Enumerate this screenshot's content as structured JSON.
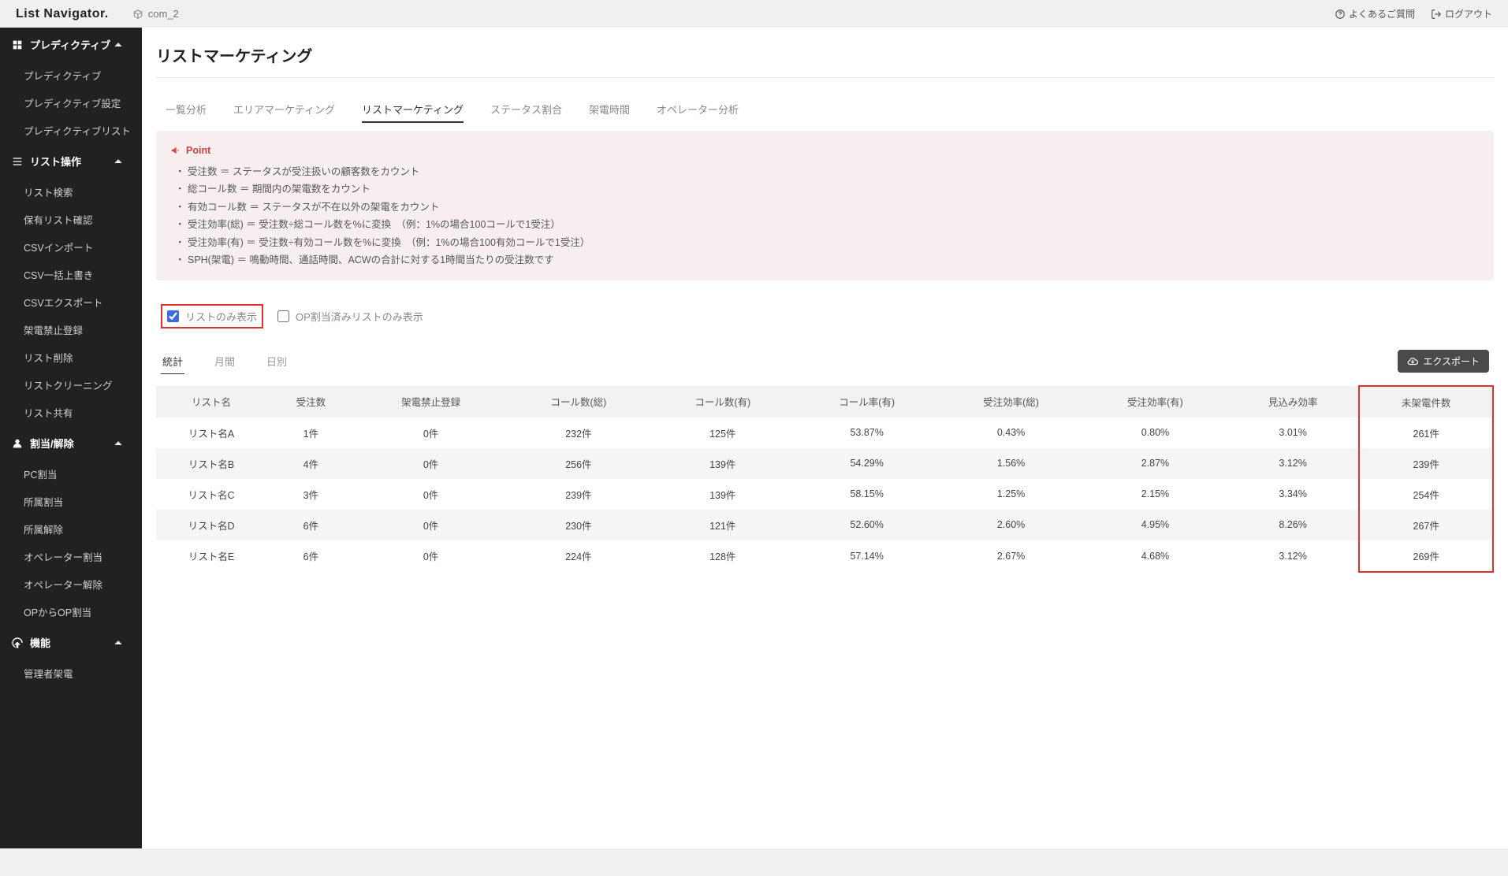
{
  "header": {
    "logo": "List Navigator.",
    "org": "com_2",
    "faq": "よくあるご質問",
    "logout": "ログアウト"
  },
  "sidebar": {
    "sections": [
      {
        "title": "プレディクティブ",
        "items": [
          "プレディクティブ",
          "プレディクティブ設定",
          "プレディクティブリスト"
        ]
      },
      {
        "title": "リスト操作",
        "items": [
          "リスト検索",
          "保有リスト確認",
          "CSVインポート",
          "CSV一括上書き",
          "CSVエクスポート",
          "架電禁止登録",
          "リスト削除",
          "リストクリーニング",
          "リスト共有"
        ]
      },
      {
        "title": "割当/解除",
        "items": [
          "PC割当",
          "所属割当",
          "所属解除",
          "オペレーター割当",
          "オペレーター解除",
          "OPからOP割当"
        ]
      },
      {
        "title": "機能",
        "items": [
          "管理者架電"
        ]
      }
    ]
  },
  "page": {
    "title": "リストマーケティング",
    "tabs": [
      "一覧分析",
      "エリアマーケティング",
      "リストマーケティング",
      "ステータス割合",
      "架電時間",
      "オペレーター分析"
    ],
    "active_tab": 2
  },
  "point": {
    "label": "Point",
    "items": [
      "受注数 ＝ ステータスが受注扱いの顧客数をカウント",
      "総コール数 ＝ 期間内の架電数をカウント",
      "有効コール数 ＝ ステータスが不在以外の架電をカウント",
      "受注効率(総) ＝ 受注数÷総コール数を%に変換　（例：1%の場合100コールで1受注）",
      "受注効率(有) ＝ 受注数÷有効コール数を%に変換　（例：1%の場合100有効コールで1受注）",
      "SPH(架電) ＝ 鳴動時間、通話時間、ACWの合計に対する1時間当たりの受注数です"
    ]
  },
  "filters": {
    "list_only": "リストのみ表示",
    "op_assigned_only": "OP割当済みリストのみ表示"
  },
  "subtabs": {
    "stat": "統計",
    "monthly": "月間",
    "daily": "日別"
  },
  "export_label": "エクスポート",
  "table": {
    "headers": [
      "リスト名",
      "受注数",
      "架電禁止登録",
      "コール数(総)",
      "コール数(有)",
      "コール率(有)",
      "受注効率(総)",
      "受注効率(有)",
      "見込み効率",
      "未架電件数"
    ],
    "rows": [
      {
        "name": "リスト名A",
        "orders": "1件",
        "banned": "0件",
        "calls_total": "232件",
        "calls_valid": "125件",
        "call_rate": "53.87%",
        "eff_total": "0.43%",
        "eff_valid": "0.80%",
        "prospect": "3.01%",
        "uncalled": "261件"
      },
      {
        "name": "リスト名B",
        "orders": "4件",
        "banned": "0件",
        "calls_total": "256件",
        "calls_valid": "139件",
        "call_rate": "54.29%",
        "eff_total": "1.56%",
        "eff_valid": "2.87%",
        "prospect": "3.12%",
        "uncalled": "239件"
      },
      {
        "name": "リスト名C",
        "orders": "3件",
        "banned": "0件",
        "calls_total": "239件",
        "calls_valid": "139件",
        "call_rate": "58.15%",
        "eff_total": "1.25%",
        "eff_valid": "2.15%",
        "prospect": "3.34%",
        "uncalled": "254件"
      },
      {
        "name": "リスト名D",
        "orders": "6件",
        "banned": "0件",
        "calls_total": "230件",
        "calls_valid": "121件",
        "call_rate": "52.60%",
        "eff_total": "2.60%",
        "eff_valid": "4.95%",
        "prospect": "8.26%",
        "uncalled": "267件"
      },
      {
        "name": "リスト名E",
        "orders": "6件",
        "banned": "0件",
        "calls_total": "224件",
        "calls_valid": "128件",
        "call_rate": "57.14%",
        "eff_total": "2.67%",
        "eff_valid": "4.68%",
        "prospect": "3.12%",
        "uncalled": "269件"
      }
    ]
  }
}
